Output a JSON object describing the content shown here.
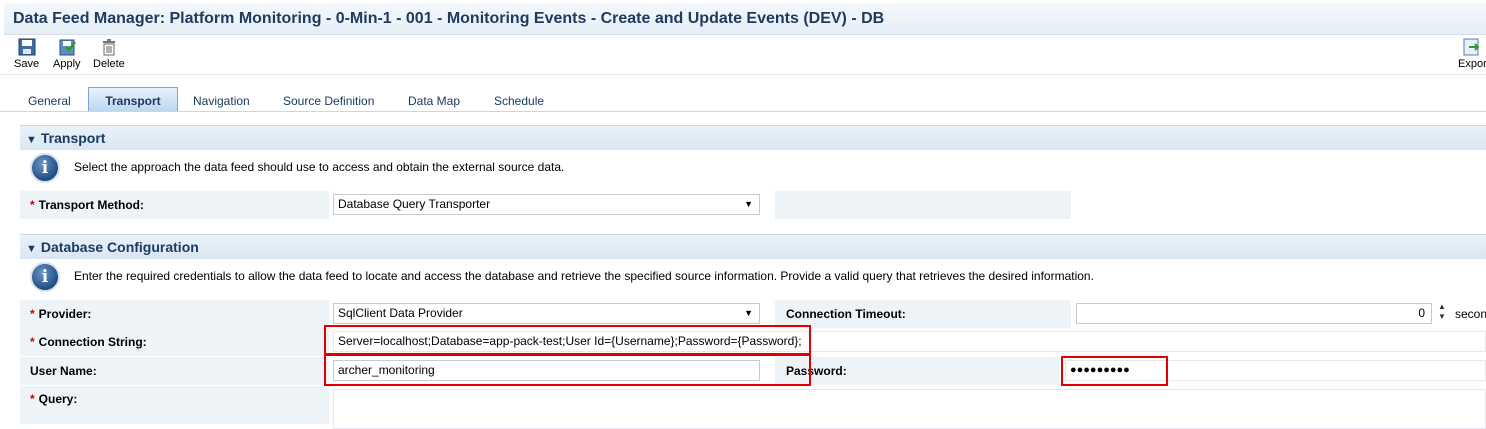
{
  "window": {
    "title": "Data Feed Manager: Platform Monitoring - 0-Min-1 - 001 - Monitoring Events - Create and Update Events (DEV) - DB"
  },
  "toolbar": {
    "save": "Save",
    "apply": "Apply",
    "delete": "Delete",
    "export": "Expor"
  },
  "tabs": [
    {
      "label": "General",
      "active": false
    },
    {
      "label": "Transport",
      "active": true
    },
    {
      "label": "Navigation",
      "active": false
    },
    {
      "label": "Source Definition",
      "active": false
    },
    {
      "label": "Data Map",
      "active": false
    },
    {
      "label": "Schedule",
      "active": false
    }
  ],
  "transport": {
    "header": "Transport",
    "info": "Select the approach the data feed should use to access and obtain the external source data.",
    "method_label": "Transport Method:",
    "method_value": "Database Query Transporter"
  },
  "db": {
    "header": "Database Configuration",
    "info": "Enter the required credentials to allow the data feed to locate and access the database and retrieve the specified source information. Provide a valid query that retrieves the desired information.",
    "provider_label": "Provider:",
    "provider_value": "SqlClient Data Provider",
    "timeout_label": "Connection Timeout:",
    "timeout_value": "0",
    "timeout_unit": "secon",
    "connstr_label": "Connection String:",
    "connstr_value": "Server=localhost;Database=app-pack-test;User Id={Username};Password={Password};",
    "username_label": "User Name:",
    "username_value": "archer_monitoring",
    "password_label": "Password:",
    "password_value": "●●●●●●●●●",
    "query_label": "Query:"
  },
  "colors": {
    "highlight": "#e00000",
    "header_text": "#1b3a60",
    "label_bg": "#eef3f8"
  }
}
